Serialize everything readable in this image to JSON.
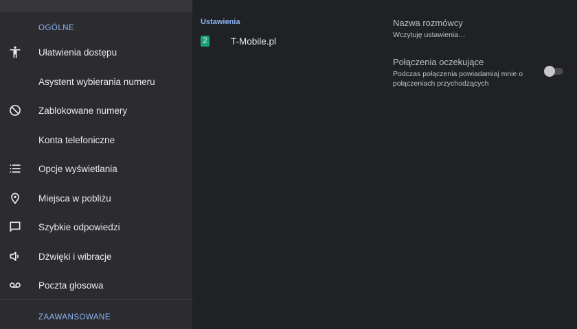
{
  "nav": {
    "section_general": "OGÓLNE",
    "section_advanced": "ZAAWANSOWANE",
    "items": [
      {
        "label": "Ułatwienia dostępu",
        "icon": "accessibility-icon"
      },
      {
        "label": "Asystent wybierania numeru",
        "icon": ""
      },
      {
        "label": "Zablokowane numery",
        "icon": "block-icon"
      },
      {
        "label": "Konta telefoniczne",
        "icon": ""
      },
      {
        "label": "Opcje wyświetlania",
        "icon": "list-icon"
      },
      {
        "label": "Miejsca w pobliżu",
        "icon": "location-pin-icon"
      },
      {
        "label": "Szybkie odpowiedzi",
        "icon": "chat-bubble-icon"
      },
      {
        "label": "Dźwięki i wibracje",
        "icon": "speaker-icon"
      },
      {
        "label": "Poczta głosowa",
        "icon": "voicemail-icon"
      }
    ]
  },
  "middle": {
    "title": "Ustawienia",
    "sim": {
      "badge": "2",
      "label": "T-Mobile.pl",
      "badge_color": "#1aa079"
    }
  },
  "right": {
    "caller_id": {
      "title": "Nazwa rozmówcy",
      "subtitle": "Wczytuję ustawienia…"
    },
    "call_waiting": {
      "title": "Połączenia oczekujące",
      "subtitle": "Podczas połączenia powiadamiaj mnie o połączeniach przychodzących",
      "enabled": false
    }
  },
  "colors": {
    "accent": "#8ab4f8",
    "background": "#202124",
    "nav_background": "#2c2c2e"
  }
}
